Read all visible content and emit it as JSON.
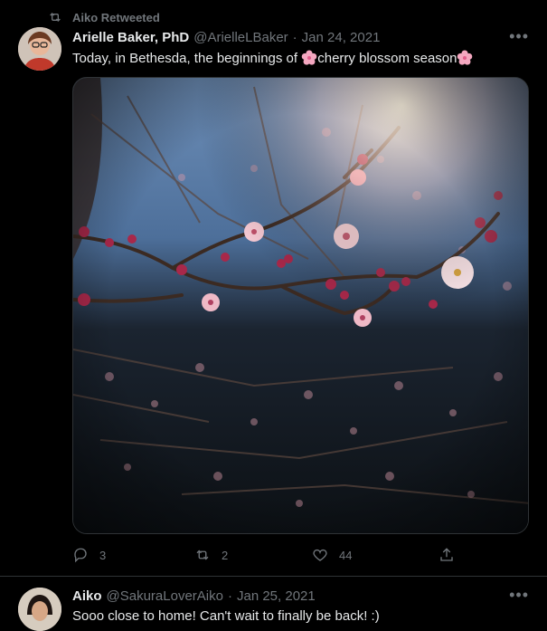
{
  "retweet_banner": {
    "text": "Aiko Retweeted"
  },
  "tweets": [
    {
      "author_name": "Arielle Baker, PhD",
      "handle": "@ArielleLBaker",
      "separator": "·",
      "date": "Jan 24, 2021",
      "text_before": "Today, in Bethesda, the beginnings of ",
      "text_middle": "cherry blossom season",
      "replies": "3",
      "retweets": "2",
      "likes": "44"
    },
    {
      "author_name": "Aiko",
      "handle": "@SakuraLoverAiko",
      "separator": "·",
      "date": "Jan 25, 2021",
      "text": "Sooo close to home! Can't wait to finally be back! :)"
    }
  ],
  "icons": {
    "retweet": "retweet-icon",
    "reply": "reply-icon",
    "like": "heart-icon",
    "share": "share-icon",
    "more": "more-icon",
    "blossom": "cherry-blossom-emoji"
  },
  "colors": {
    "background": "#000000",
    "text": "#e7e9ea",
    "muted": "#71767b",
    "divider": "#2f3336",
    "blossom": "#f4a7c0"
  }
}
